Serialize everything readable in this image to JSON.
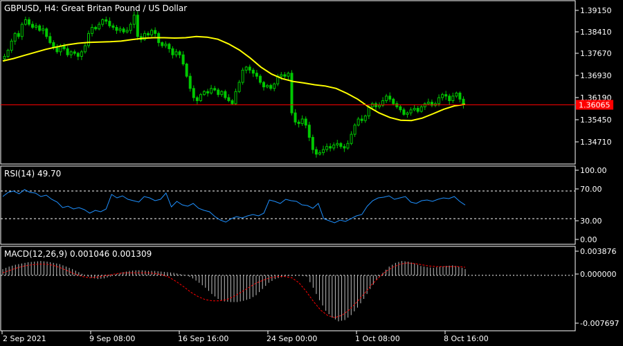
{
  "colors": {
    "background": "#000000",
    "frame": "#ffffff",
    "bull": "#00c800",
    "bear": "#00c800",
    "wick": "#00c800",
    "ma": "#ffff00",
    "bid_line": "#ff0000",
    "rsi": "#1e90ff",
    "level_line": "#ffffff",
    "macd_hist": "#c0c0c0",
    "macd_signal": "#ff0000"
  },
  "header": {
    "symbol_line": "GBPUSD, H4:  Great Britan Pound / US Dollar",
    "rsi_label": "RSI(14) 49.70",
    "macd_label": "MACD(12,26,9) 0.001046 0.001309"
  },
  "price_axis": {
    "ticks": [
      "1.39150",
      "1.38410",
      "1.37670",
      "1.36930",
      "1.36190",
      "1.35450",
      "1.34710"
    ],
    "current_price": "1.36065"
  },
  "rsi_axis": {
    "ticks": [
      "100.00",
      "70.00",
      "30.00",
      "0.00"
    ]
  },
  "macd_axis": {
    "ticks": [
      "0.003876",
      "0.000000",
      "-0.007697"
    ]
  },
  "time_axis": {
    "labels": [
      "2 Sep 2021",
      "9 Sep 08:00",
      "16 Sep 16:00",
      "24 Sep 00:00",
      "1 Oct 08:00",
      "8 Oct 16:00"
    ]
  },
  "chart_data": [
    {
      "type": "candlestick",
      "title": "GBPUSD, H4:  Great Britan Pound / US Dollar",
      "ylim": [
        1.3415,
        1.3945
      ],
      "series": [
        {
          "name": "GBPUSD H4",
          "close_path": [
            1.3765,
            1.3785,
            1.3815,
            1.384,
            1.383,
            1.387,
            1.3885,
            1.387,
            1.386,
            1.3865,
            1.385,
            1.3855,
            1.383,
            1.381,
            1.3795,
            1.378,
            1.38,
            1.379,
            1.377,
            1.378,
            1.3775,
            1.3765,
            1.378,
            1.38,
            1.384,
            1.386,
            1.3855,
            1.387,
            1.3885,
            1.388,
            1.3865,
            1.386,
            1.385,
            1.3855,
            1.3845,
            1.385,
            1.387,
            1.39,
            1.383,
            1.382,
            1.384,
            1.3835,
            1.385,
            1.384,
            1.381,
            1.38,
            1.3805,
            1.379,
            1.377,
            1.378,
            1.377,
            1.374,
            1.37,
            1.366,
            1.363,
            1.362,
            1.364,
            1.365,
            1.3645,
            1.366,
            1.3655,
            1.364,
            1.365,
            1.363,
            1.362,
            1.361,
            1.365,
            1.368,
            1.372,
            1.373,
            1.372,
            1.371,
            1.37,
            1.368,
            1.3665,
            1.367,
            1.366,
            1.3675,
            1.37,
            1.3705,
            1.37,
            1.371,
            1.358,
            1.355,
            1.3545,
            1.356,
            1.354,
            1.35,
            1.346,
            1.3445,
            1.345,
            1.346,
            1.347,
            1.3465,
            1.3475,
            1.348,
            1.347,
            1.3465,
            1.348,
            1.351,
            1.354,
            1.356,
            1.3555,
            1.357,
            1.36,
            1.361,
            1.36,
            1.3605,
            1.362,
            1.3635,
            1.3625,
            1.361,
            1.36,
            1.359,
            1.3575,
            1.358,
            1.359,
            1.3595,
            1.3585,
            1.36,
            1.361,
            1.3615,
            1.3605,
            1.361,
            1.363,
            1.364,
            1.3635,
            1.362,
            1.3635,
            1.3645,
            1.3625,
            1.3607
          ]
        },
        {
          "name": "Moving Average",
          "values": [
            1.375,
            1.3758,
            1.3768,
            1.3778,
            1.3788,
            1.3796,
            1.3803,
            1.3808,
            1.3811,
            1.3812,
            1.3813,
            1.3815,
            1.382,
            1.3824,
            1.3826,
            1.3826,
            1.3825,
            1.3826,
            1.383,
            1.3828,
            1.3821,
            1.3806,
            1.3786,
            1.376,
            1.373,
            1.3707,
            1.3692,
            1.3683,
            1.3678,
            1.3672,
            1.3668,
            1.366,
            1.3644,
            1.3625,
            1.36,
            1.358,
            1.3565,
            1.3556,
            1.3555,
            1.3563,
            1.3577,
            1.3592,
            1.3603,
            1.3608
          ]
        }
      ],
      "bid_price": 1.36065
    },
    {
      "type": "line",
      "title": "RSI(14) 49.70",
      "ylim": [
        0,
        100
      ],
      "levels": [
        70,
        30
      ],
      "series": [
        {
          "name": "RSI(14)",
          "values": [
            62,
            68,
            70,
            66,
            72,
            68,
            67,
            62,
            64,
            58,
            54,
            46,
            48,
            44,
            46,
            43,
            38,
            42,
            40,
            44,
            65,
            60,
            63,
            58,
            56,
            54,
            62,
            60,
            56,
            58,
            67,
            47,
            55,
            50,
            48,
            52,
            45,
            42,
            40,
            33,
            28,
            25,
            30,
            33,
            31,
            34,
            36,
            34,
            38,
            57,
            55,
            52,
            58,
            56,
            55,
            50,
            49,
            45,
            52,
            30,
            27,
            24,
            28,
            26,
            30,
            34,
            36,
            48,
            56,
            60,
            61,
            63,
            58,
            60,
            62,
            54,
            52,
            56,
            57,
            55,
            58,
            60,
            59,
            62,
            55,
            49.7
          ]
        }
      ]
    },
    {
      "type": "bar",
      "title": "MACD(12,26,9) 0.001046 0.001309",
      "ylim": [
        -0.007697,
        0.003876
      ],
      "series": [
        {
          "name": "MACD",
          "values": [
            0.001,
            0.0014,
            0.0017,
            0.0019,
            0.0021,
            0.0022,
            0.0023,
            0.0022,
            0.002,
            0.0018,
            0.0014,
            0.001,
            0.0005,
            0.0,
            -0.0004,
            -0.0006,
            -0.0005,
            -0.0002,
            0.0002,
            0.0005,
            0.0007,
            0.0008,
            0.0008,
            0.0007,
            0.0007,
            0.0006,
            0.0005,
            0.0004,
            0.0002,
            0.0,
            -0.0005,
            -0.0012,
            -0.002,
            -0.003,
            -0.0038,
            -0.0042,
            -0.0043,
            -0.0043,
            -0.0041,
            -0.0038,
            -0.0032,
            -0.0022,
            -0.0012,
            -0.0006,
            -0.0003,
            -0.0001,
            0.0,
            0.0,
            -0.0002,
            -0.002,
            -0.004,
            -0.0057,
            -0.0068,
            -0.0074,
            -0.0072,
            -0.0064,
            -0.0052,
            -0.0038,
            -0.0022,
            -0.0008,
            0.0004,
            0.0014,
            0.002,
            0.0023,
            0.0022,
            0.0019,
            0.0015,
            0.0013,
            0.0012,
            0.0014,
            0.0015,
            0.0016,
            0.0014,
            0.001
          ]
        },
        {
          "name": "Signal",
          "values": [
            0.0004,
            0.0008,
            0.0012,
            0.0015,
            0.0017,
            0.0018,
            0.0018,
            0.0016,
            0.0012,
            0.0007,
            0.0002,
            -0.0002,
            -0.0004,
            -0.0003,
            -0.0001,
            0.0001,
            0.0003,
            0.0004,
            0.0004,
            0.0004,
            0.0004,
            0.0003,
            0.0001,
            -0.0003,
            -0.001,
            -0.0018,
            -0.0027,
            -0.0034,
            -0.0039,
            -0.0041,
            -0.0041,
            -0.0039,
            -0.0034,
            -0.0027,
            -0.002,
            -0.0013,
            -0.0008,
            -0.0004,
            -0.0002,
            -0.0002,
            -0.0004,
            -0.0012,
            -0.0026,
            -0.0042,
            -0.0056,
            -0.0065,
            -0.0068,
            -0.0064,
            -0.0055,
            -0.0043,
            -0.003,
            -0.0016,
            -0.0004,
            0.0006,
            0.0013,
            0.0018,
            0.002,
            0.0019,
            0.0017,
            0.0015,
            0.0014,
            0.0014,
            0.0014,
            0.0014,
            0.0013
          ]
        }
      ]
    }
  ]
}
